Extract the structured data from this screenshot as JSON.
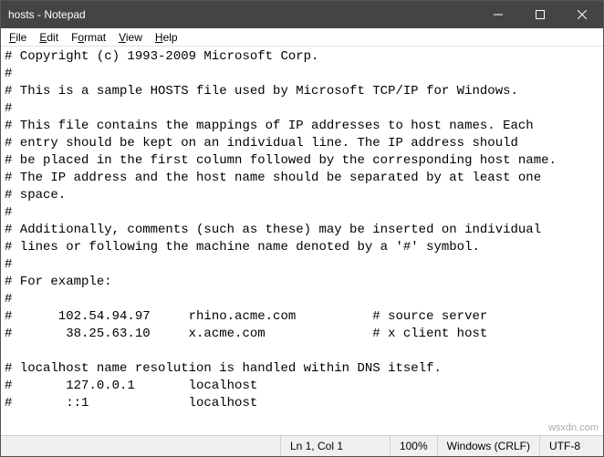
{
  "window": {
    "title": "hosts - Notepad"
  },
  "menu": {
    "file": "File",
    "edit": "Edit",
    "format": "Format",
    "view": "View",
    "help": "Help"
  },
  "content": "# Copyright (c) 1993-2009 Microsoft Corp.\n#\n# This is a sample HOSTS file used by Microsoft TCP/IP for Windows.\n#\n# This file contains the mappings of IP addresses to host names. Each\n# entry should be kept on an individual line. The IP address should\n# be placed in the first column followed by the corresponding host name.\n# The IP address and the host name should be separated by at least one\n# space.\n#\n# Additionally, comments (such as these) may be inserted on individual\n# lines or following the machine name denoted by a '#' symbol.\n#\n# For example:\n#\n#      102.54.94.97     rhino.acme.com          # source server\n#       38.25.63.10     x.acme.com              # x client host\n\n# localhost name resolution is handled within DNS itself.\n#       127.0.0.1       localhost\n#       ::1             localhost",
  "status": {
    "position": "Ln 1, Col 1",
    "zoom": "100%",
    "eol": "Windows (CRLF)",
    "encoding": "UTF-8"
  },
  "watermark": "wsxdn.com"
}
